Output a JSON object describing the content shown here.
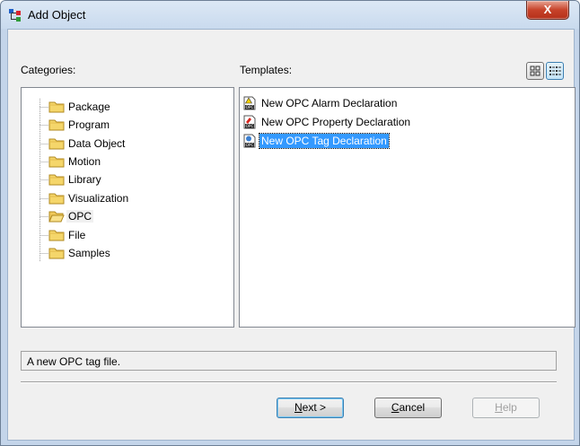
{
  "window": {
    "title": "Add Object",
    "close_glyph": "X"
  },
  "categories": {
    "label": "Categories:",
    "items": [
      {
        "label": "Package"
      },
      {
        "label": "Program"
      },
      {
        "label": "Data Object"
      },
      {
        "label": "Motion"
      },
      {
        "label": "Library"
      },
      {
        "label": "Visualization"
      },
      {
        "label": "OPC",
        "selected": true
      },
      {
        "label": "File"
      },
      {
        "label": "Samples"
      }
    ]
  },
  "templates": {
    "label": "Templates:",
    "view_buttons": [
      "large-icons-view-icon",
      "list-view-icon"
    ],
    "items": [
      {
        "label": "New OPC Alarm Declaration",
        "icon": "opc-alarm-icon"
      },
      {
        "label": "New OPC Property Declaration",
        "icon": "opc-property-icon"
      },
      {
        "label": "New OPC Tag Declaration",
        "icon": "opc-tag-icon",
        "selected": true
      }
    ]
  },
  "description": "A new OPC tag file.",
  "buttons": {
    "next": {
      "label": "Next >",
      "underline": "N",
      "rest": "ext >"
    },
    "cancel": {
      "label": "Cancel",
      "underline": "C",
      "rest": "ancel"
    },
    "help": {
      "label": "Help",
      "underline": "H",
      "rest": "elp"
    }
  },
  "colors": {
    "selection": "#3399ff",
    "folder": "#f5d66a",
    "title_bar": "#c9daee",
    "close_button": "#c7432a"
  }
}
